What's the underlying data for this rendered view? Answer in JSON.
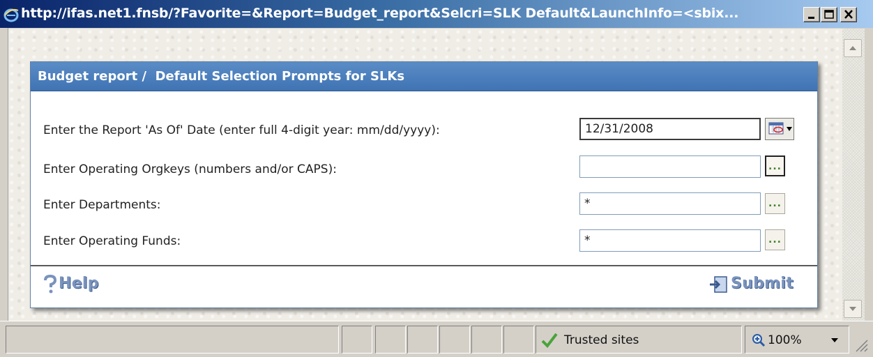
{
  "window": {
    "title": "http://ifas.net1.fnsb/?Favorite=&Report=Budget_report&Selcri=SLK Default&LaunchInfo=<sbix..."
  },
  "dialog": {
    "title": "Budget report /  Default Selection Prompts for SLKs",
    "prompts": [
      {
        "label": "Enter the Report 'As Of' Date (enter full 4-digit year: mm/dd/yyyy):",
        "value": "12/31/2008"
      },
      {
        "label": "Enter Operating Orgkeys (numbers and/or CAPS):",
        "value": ""
      },
      {
        "label": "Enter Departments:",
        "value": "*"
      },
      {
        "label": "Enter Operating Funds:",
        "value": "*"
      }
    ],
    "lookup_button_label": "...",
    "help_label": "Help",
    "submit_label": "Submit"
  },
  "statusbar": {
    "zone": "Trusted sites",
    "zoom": "100%"
  },
  "icons": {
    "calendar": "calendar-icon",
    "help": "help-icon",
    "submit": "submit-icon",
    "zone": "check-icon",
    "zoom": "zoom-icon"
  },
  "colors": {
    "header_bg": "#4a7fbf",
    "link_text": "#7a93bd",
    "lookup_dots": "#3f7f2a"
  }
}
